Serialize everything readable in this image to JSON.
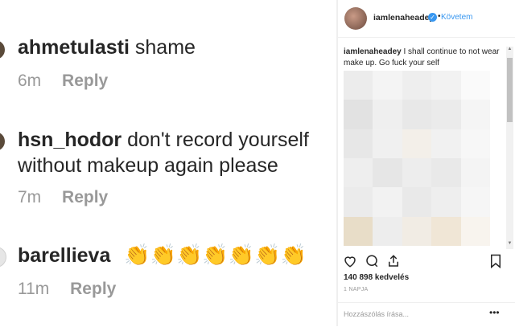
{
  "comments": [
    {
      "user": "ahmetulasti",
      "text": "shame",
      "time": "6m",
      "reply": "Reply"
    },
    {
      "user": "hsn_hodor",
      "text": "don't record yourself",
      "text2": "without makeup again please",
      "time": "7m",
      "reply": "Reply"
    },
    {
      "user": "barellieva",
      "text": "👏👏👏👏👏👏👏",
      "time": "11m",
      "reply": "Reply"
    }
  ],
  "post": {
    "username": "iamlenaheadey",
    "follow_label": "Követem",
    "caption_user": "iamlenaheadey",
    "caption_text": "I shall continue to not wear make up. Go fuck your self",
    "likes": "140 898 kedvelés",
    "time_ago": "1 NAPJA",
    "comment_placeholder": "Hozzászólás írása...",
    "more_label": "•••"
  },
  "colors": {
    "accent": "#3897f0",
    "muted": "#999999",
    "text": "#262626"
  },
  "icons": [
    "heart-icon",
    "comment-icon",
    "share-icon",
    "bookmark-icon",
    "verified-badge-icon"
  ]
}
